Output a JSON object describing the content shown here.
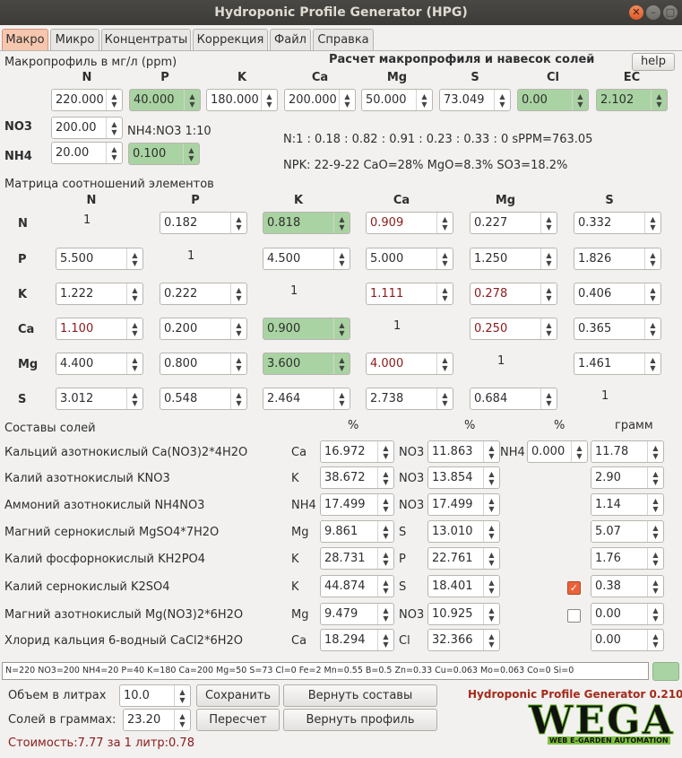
{
  "window": {
    "title": "Hydroponic Profile Generator (HPG)"
  },
  "tabs": [
    "Макро",
    "Микро",
    "Концентраты",
    "Коррекция",
    "Файл",
    "Справка"
  ],
  "macro": {
    "profile_label": "Макропрофиль в мг/л (ppm)",
    "calc_title": "Расчет макропрофиля и навесок солей",
    "help_label": "help",
    "headers": [
      "N",
      "P",
      "K",
      "Ca",
      "Mg",
      "S",
      "Cl",
      "EC"
    ],
    "values": [
      "220.000",
      "40.000",
      "180.000",
      "200.000",
      "50.000",
      "73.049",
      "0.00",
      "2.102"
    ],
    "no3_label": "NO3",
    "no3_value": "200.00",
    "nh4_label": "NH4",
    "nh4_value": "20.00",
    "ratio_label": "NH4:NO3 1:10",
    "ratio_value": "0.100",
    "summary1": "N:1 : 0.18 : 0.82 : 0.91 : 0.23 : 0.33 : 0 sPPM=763.05",
    "summary2": "NPK: 22-9-22 CaO=28% MgO=8.3% SO3=18.2%"
  },
  "matrix": {
    "title": "Матрица соотношений элементов",
    "cols": [
      "N",
      "P",
      "K",
      "Ca",
      "Mg",
      "S"
    ],
    "rows": [
      {
        "name": "N",
        "cells": [
          "1",
          "0.182",
          "0.818",
          "0.909",
          "0.227",
          "0.332"
        ]
      },
      {
        "name": "P",
        "cells": [
          "5.500",
          "1",
          "4.500",
          "5.000",
          "1.250",
          "1.826"
        ]
      },
      {
        "name": "K",
        "cells": [
          "1.222",
          "0.222",
          "1",
          "1.111",
          "0.278",
          "0.406"
        ]
      },
      {
        "name": "Ca",
        "cells": [
          "1.100",
          "0.200",
          "0.900",
          "1",
          "0.250",
          "0.365"
        ]
      },
      {
        "name": "Mg",
        "cells": [
          "4.400",
          "0.800",
          "3.600",
          "4.000",
          "1",
          "1.461"
        ]
      },
      {
        "name": "S",
        "cells": [
          "3.012",
          "0.548",
          "2.464",
          "2.738",
          "0.684",
          "1"
        ]
      }
    ]
  },
  "salts": {
    "title": "Составы солей",
    "pct": "%",
    "gram": "грамм",
    "rows": [
      {
        "name": "Кальций азотнокислый Ca(NO3)2*4H2O",
        "e1": "Ca",
        "v1": "16.972",
        "e2": "NO3",
        "v2": "11.863",
        "e3": "NH4",
        "v3": "0.000",
        "g": "11.78"
      },
      {
        "name": "Калий азотнокислый KNO3",
        "e1": "K",
        "v1": "38.672",
        "e2": "NO3",
        "v2": "13.854",
        "g": "2.90"
      },
      {
        "name": "Аммоний азотнокислый NH4NO3",
        "e1": "NH4",
        "v1": "17.499",
        "e2": "NO3",
        "v2": "17.499",
        "g": "1.14"
      },
      {
        "name": "Магний сернокислый MgSO4*7H2O",
        "e1": "Mg",
        "v1": "9.861",
        "e2": "S",
        "v2": "13.010",
        "g": "5.07"
      },
      {
        "name": "Калий фосфорнокислый KH2PO4",
        "e1": "K",
        "v1": "28.731",
        "e2": "P",
        "v2": "22.761",
        "g": "1.76"
      },
      {
        "name": "Калий сернокислый K2SO4",
        "e1": "K",
        "v1": "44.874",
        "e2": "S",
        "v2": "18.401",
        "g": "0.38"
      },
      {
        "name": "Магний азотнокислый Mg(NO3)2*6H2O",
        "e1": "Mg",
        "v1": "9.479",
        "e2": "NO3",
        "v2": "10.925",
        "g": "0.00"
      },
      {
        "name": "Хлорид кальция 6-водный CaCl2*6H2O",
        "e1": "Ca",
        "v1": "18.294",
        "e2": "Cl",
        "v2": "32.366",
        "g": "0.00"
      }
    ]
  },
  "status": "N=220 NO3=200 NH4=20 P=40 K=180 Ca=200 Mg=50 S=73 Cl=0 Fe=2 Mn=0.55 B=0.5 Zn=0.33 Cu=0.063 Mo=0.063 Co=0 Si=0",
  "bottom": {
    "volume_label": "Объем в литрах",
    "volume": "10.0",
    "salts_label": "Солей в граммах:",
    "salts_value": "23.20",
    "save": "Сохранить",
    "restore_comp": "Вернуть составы",
    "recalc": "Пересчет",
    "restore_profile": "Вернуть профиль",
    "cost": "Стоимость:7.77 за 1 литр:0.78",
    "brand": "Hydroponic Profile Generator 0.210",
    "logo": "WEGA",
    "logo_sub": "WEB E-GARDEN AUTOMATION"
  },
  "colors": {
    "tab_active": "#f6c7ae",
    "green_field": "#a9d3a2",
    "red_text": "#8b1a1a",
    "brand": "#a52a1a",
    "check": "#e9623b"
  }
}
